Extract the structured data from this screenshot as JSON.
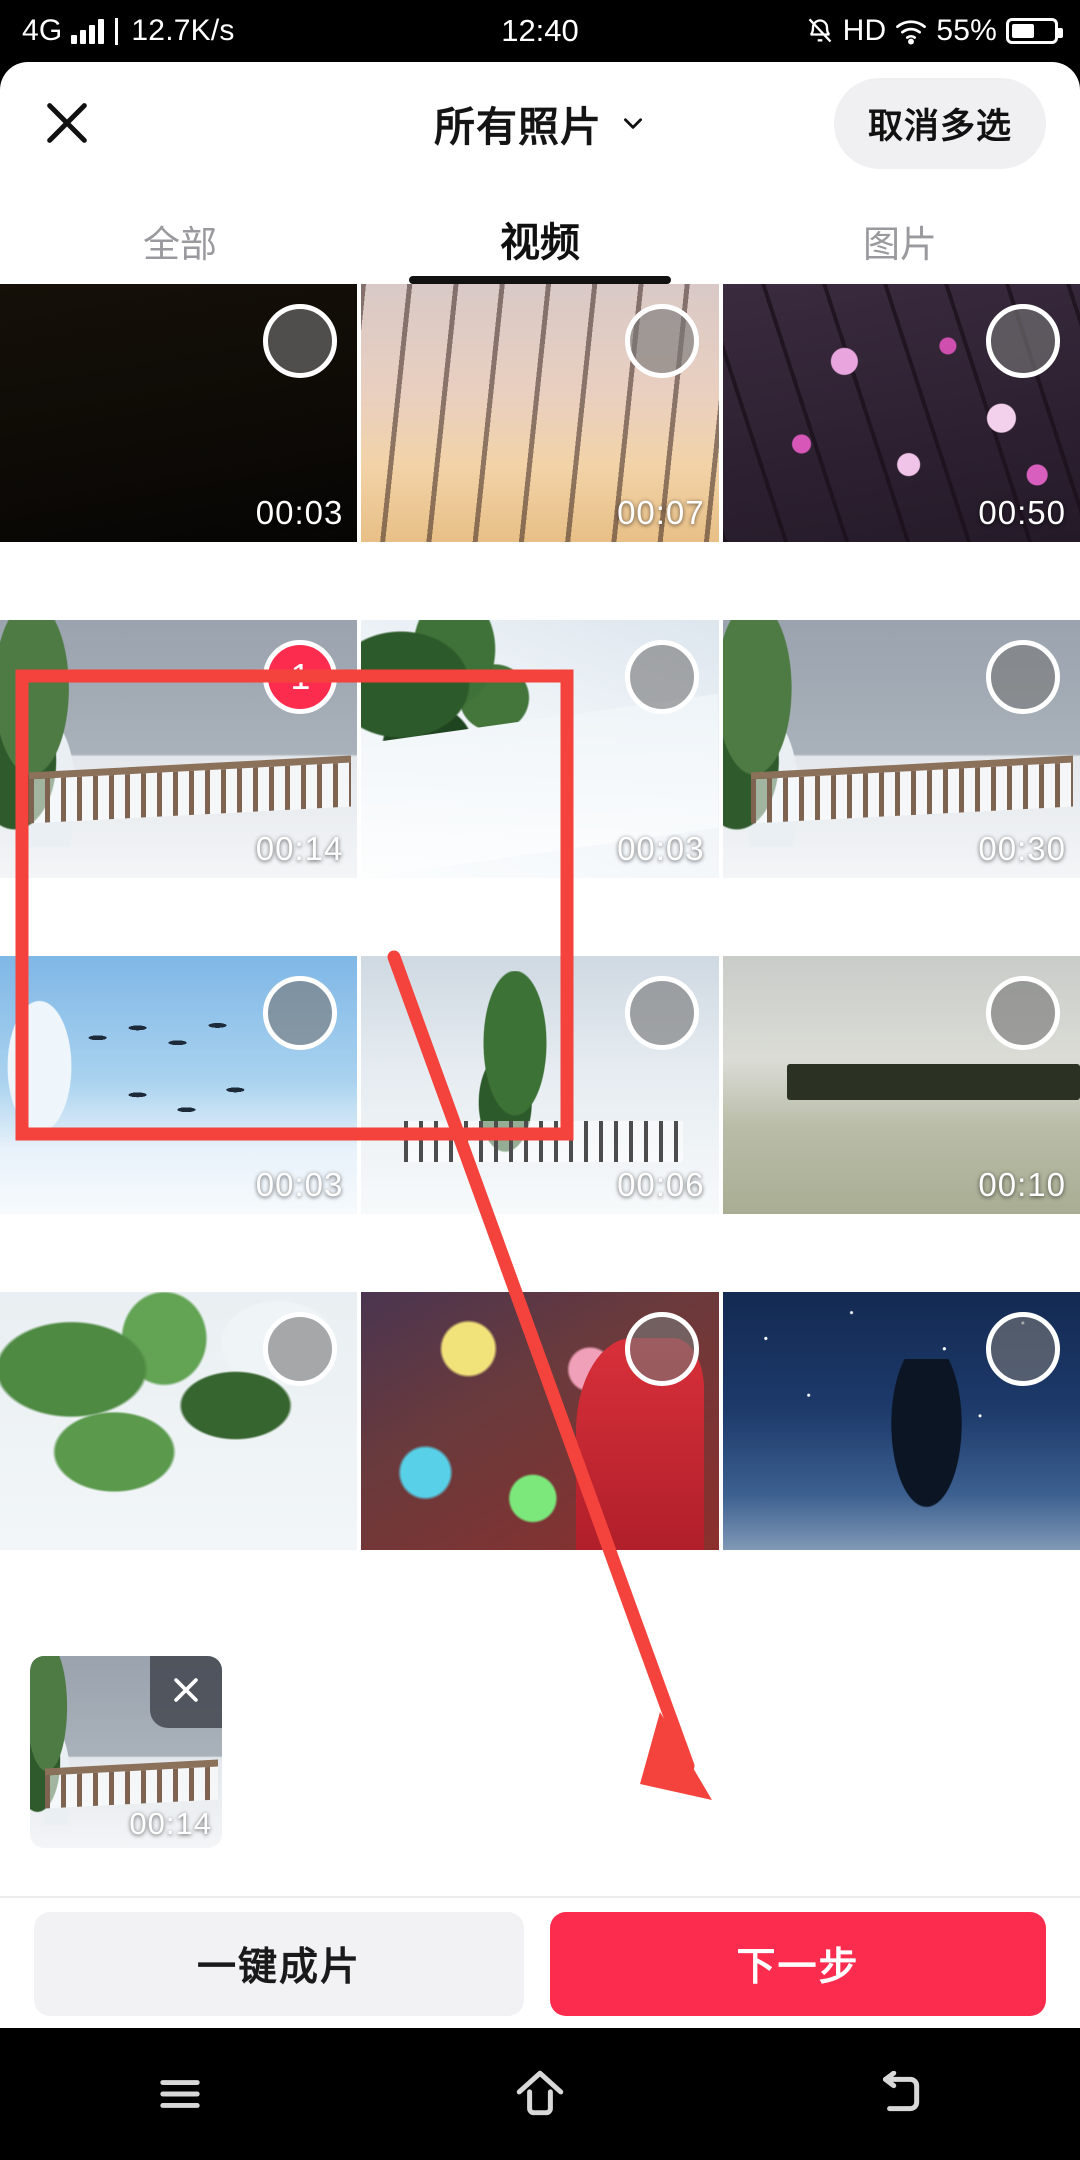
{
  "statusbar": {
    "network": "4G",
    "speed": "12.7K/s",
    "time": "12:40",
    "hd": "HD",
    "battery_percent": "55%",
    "signal_icon": "signal-bars-icon",
    "mute_icon": "bell-muted-icon",
    "wifi_icon": "wifi-icon",
    "battery_icon": "battery-icon"
  },
  "header": {
    "close_icon": "close-icon",
    "title": "所有照片",
    "chevron_icon": "chevron-down-icon",
    "multiselect_label": "取消多选"
  },
  "tabs": [
    {
      "label": "全部",
      "active": false
    },
    {
      "label": "视频",
      "active": true
    },
    {
      "label": "图片",
      "active": false
    }
  ],
  "grid": {
    "items": [
      {
        "duration": "00:03",
        "art": "t-dark",
        "selected": false,
        "badge": ""
      },
      {
        "duration": "00:07",
        "art": "t-trees",
        "selected": false,
        "badge": ""
      },
      {
        "duration": "00:50",
        "art": "t-blossom",
        "selected": false,
        "badge": ""
      },
      {
        "duration": "00:14",
        "art": "t-fence",
        "selected": true,
        "badge": "1"
      },
      {
        "duration": "00:03",
        "art": "t-slope",
        "selected": false,
        "badge": ""
      },
      {
        "duration": "00:30",
        "art": "t-fence",
        "selected": false,
        "badge": ""
      },
      {
        "duration": "00:03",
        "art": "t-birds",
        "selected": false,
        "badge": ""
      },
      {
        "duration": "00:06",
        "art": "t-yard",
        "selected": false,
        "badge": ""
      },
      {
        "duration": "00:10",
        "art": "t-lake",
        "selected": false,
        "badge": ""
      },
      {
        "duration": "",
        "art": "t-snowleaf",
        "selected": false,
        "badge": ""
      },
      {
        "duration": "",
        "art": "t-fest",
        "selected": false,
        "badge": ""
      },
      {
        "duration": "",
        "art": "t-night",
        "selected": false,
        "badge": ""
      }
    ]
  },
  "selection_strip": {
    "chips": [
      {
        "duration": "00:14",
        "art": "t-fence",
        "remove_icon": "close-icon"
      }
    ]
  },
  "actions": {
    "secondary_label": "一键成片",
    "primary_label": "下一步"
  },
  "navbar": {
    "menu_icon": "menu-icon",
    "home_icon": "home-icon",
    "back_icon": "back-icon"
  },
  "annotations": {
    "highlight_box_color": "#f4433c",
    "arrow_color": "#f4433c"
  },
  "colors": {
    "accent": "#fb2c4e",
    "sheet_background": "#ffffff",
    "chrome_background": "#000000",
    "tab_active": "#101010",
    "tab_inactive": "#9a9a9e"
  }
}
